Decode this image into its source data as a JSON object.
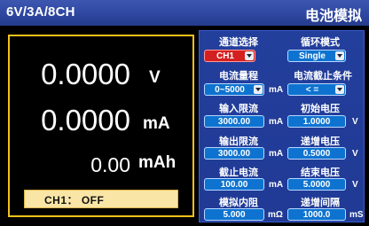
{
  "header": {
    "model": "6V/3A/8CH",
    "mode_title": "电池模拟"
  },
  "measurements": {
    "voltage": {
      "value": "0.0000",
      "unit": "V"
    },
    "current": {
      "value": "0.0000",
      "unit": "mA"
    },
    "capacity": {
      "value": "0.00",
      "unit": "mAh"
    }
  },
  "status": {
    "text": "CH1：  OFF"
  },
  "settings": {
    "channel": {
      "label": "通道选择",
      "value": "CH1"
    },
    "loop_mode": {
      "label": "循环模式",
      "value": "Single"
    },
    "current_range": {
      "label": "电流量程",
      "value": "0~5000",
      "unit": "mA"
    },
    "cutoff_condition": {
      "label": "电流截止条件",
      "value": "< ="
    },
    "input_limit": {
      "label": "输入限流",
      "value": "3000.00",
      "unit": "mA"
    },
    "initial_voltage": {
      "label": "初始电压",
      "value": "1.0000",
      "unit": "V"
    },
    "output_limit": {
      "label": "输出限流",
      "value": "3000.00",
      "unit": "mA"
    },
    "step_voltage": {
      "label": "递增电压",
      "value": "0.5000",
      "unit": "V"
    },
    "cutoff_current": {
      "label": "截止电流",
      "value": "100.00",
      "unit": "mA"
    },
    "end_voltage": {
      "label": "结束电压",
      "value": "5.0000",
      "unit": "V"
    },
    "internal_resistance": {
      "label": "模拟内阻",
      "value": "5.000",
      "unit": "mΩ"
    },
    "step_interval": {
      "label": "递增间隔",
      "value": "1000.0",
      "unit": "mS"
    }
  },
  "colors": {
    "header_bg": "#2d459e",
    "panel_border": "#f2c21b",
    "settings_bg": "#223d99",
    "field_bg": "#0e73d0",
    "channel_field_bg": "#d42020",
    "status_bg": "#f9e6a6"
  },
  "icons": {
    "dropdown": "chevron-down-icon"
  }
}
